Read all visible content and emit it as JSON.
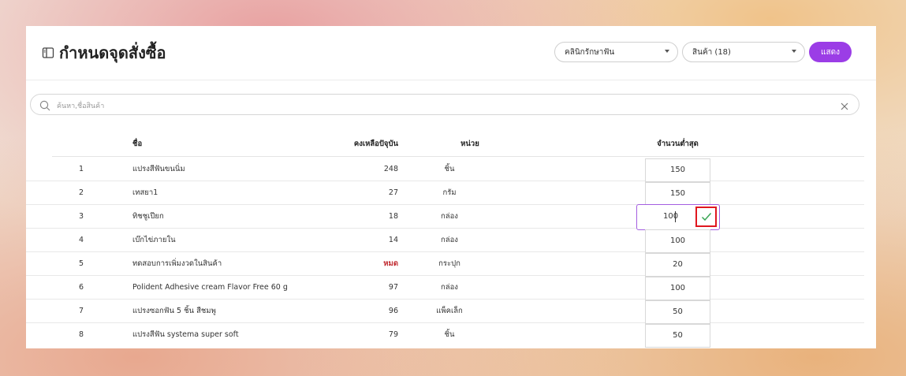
{
  "header": {
    "title": "กำหนดจุดสั่งซื้อ",
    "clinic_select": "คลินิกรักษาฟัน",
    "product_select": "สินค้า (18)",
    "show_button": "แสดง"
  },
  "search": {
    "placeholder": "ค้นหา,ชื่อสินค้า"
  },
  "table": {
    "headers": {
      "name": "ชื่อ",
      "stock": "คงเหลือปัจุบัน",
      "unit": "หน่วย",
      "min_qty": "จำนวนต่ำสุด"
    },
    "rows": [
      {
        "num": "1",
        "name": "แปรงสีฟันขนนิ่ม",
        "stock": "248",
        "unit": "ชิ้น",
        "min_qty": "150"
      },
      {
        "num": "2",
        "name": "เทสยา1",
        "stock": "27",
        "unit": "กรัม",
        "min_qty": "150"
      },
      {
        "num": "3",
        "name": "ทิชชูเปียก",
        "stock": "18",
        "unit": "กล่อง",
        "min_qty": "100"
      },
      {
        "num": "4",
        "name": "เบ๊กไข่ภายใน",
        "stock": "14",
        "unit": "กล่อง",
        "min_qty": "100"
      },
      {
        "num": "5",
        "name": "ทดสอบการเพิ่มงวดในสินค้า",
        "stock": "หมด",
        "unit": "กระปุก",
        "min_qty": "20"
      },
      {
        "num": "6",
        "name": "Polident Adhesive cream Flavor Free 60 g",
        "stock": "97",
        "unit": "กล่อง",
        "min_qty": "100"
      },
      {
        "num": "7",
        "name": "แปรงซอกฟัน 5 ชิ้น สีชมพู",
        "stock": "96",
        "unit": "แพ็คเล็ก",
        "min_qty": "50"
      },
      {
        "num": "8",
        "name": "แปรงสีฟัน systema super soft",
        "stock": "79",
        "unit": "ชิ้น",
        "min_qty": "50"
      }
    ]
  },
  "colors": {
    "accent": "#9b3de6",
    "out_of_stock": "#c0282e",
    "confirm": "#3aa655"
  }
}
